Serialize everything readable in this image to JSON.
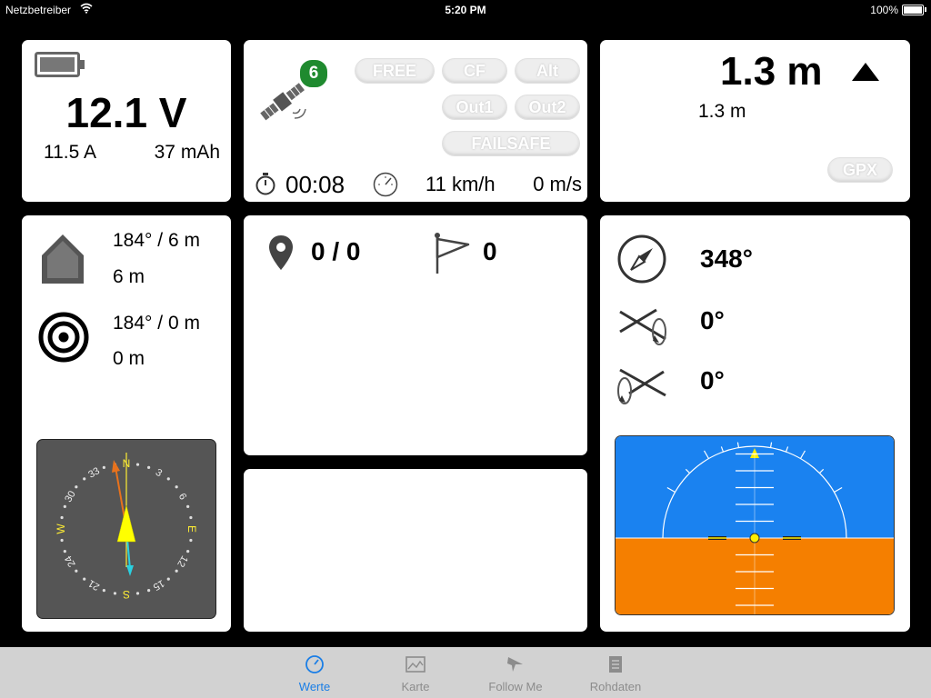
{
  "status_bar": {
    "carrier": "Netzbetreiber",
    "time": "5:20 PM",
    "battery": "100%"
  },
  "battery_panel": {
    "voltage": "12.1 V",
    "current": "11.5 A",
    "capacity": "37 mAh"
  },
  "gps_panel": {
    "satellites": "6",
    "modes": [
      "FREE",
      "CF",
      "Alt",
      "Out1",
      "Out2",
      "FAILSAFE"
    ],
    "timer": "00:08",
    "speed": "11 km/h",
    "vertical_speed": "0 m/s"
  },
  "altitude_panel": {
    "altitude": "1.3 m",
    "altitude_secondary": "1.3 m",
    "gpx_button": "GPX"
  },
  "home_panel": {
    "home_bearing_distance": "184° / 6 m",
    "home_distance": "6 m",
    "target_bearing_distance": "184° / 0 m",
    "target_distance": "0 m",
    "compass_labels": [
      "33",
      "N",
      "3",
      "6",
      "E",
      "12",
      "15",
      "S",
      "21",
      "24",
      "W",
      "30"
    ]
  },
  "waypoint_panel": {
    "waypoints": "0 / 0",
    "flags": "0"
  },
  "attitude_panel": {
    "heading": "348°",
    "roll": "0°",
    "pitch": "0°"
  },
  "tabs": [
    {
      "label": "Werte",
      "icon": "gauge-icon",
      "active": true
    },
    {
      "label": "Karte",
      "icon": "map-icon",
      "active": false
    },
    {
      "label": "Follow Me",
      "icon": "plane-icon",
      "active": false
    },
    {
      "label": "Rohdaten",
      "icon": "list-icon",
      "active": false
    }
  ],
  "colors": {
    "accent": "#1a7ee6",
    "sky": "#1a82f0",
    "ground": "#f57f00",
    "compass_bg": "#555555",
    "needle": "#ffff00"
  }
}
